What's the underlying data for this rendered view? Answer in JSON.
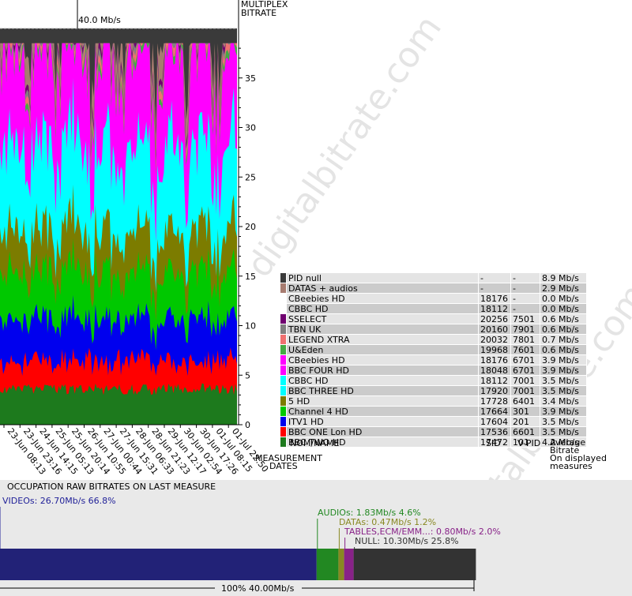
{
  "chart_data": {
    "type": "area",
    "title": "MULTIPLEX BITRATE",
    "y_unit_label": "40.0 Mb/s",
    "ylim": [
      0,
      40
    ],
    "yticks": [
      0,
      5,
      10,
      15,
      20,
      25,
      30,
      35
    ],
    "xlabel": "MEASUREMENT DATES",
    "x_ticks": [
      "23-Jun 08:13",
      "23-Jun 23:16",
      "24-Jun 14:15",
      "25-Jun 05:13",
      "25-Jun 20:14",
      "26-Jun 10:55",
      "27-Jun 00:44",
      "27-Jun 15:31",
      "28-Jun 06:33",
      "28-Jun 21:23",
      "29-Jun 12:17",
      "30-Jun 02:54",
      "30-Jun 17:26",
      "01-Jul 08:15",
      "01-Jul 22:50"
    ],
    "series": [
      {
        "name": "BBC TWO HD",
        "color": "#1d7a1d",
        "average": 4.2
      },
      {
        "name": "BBC ONE Lon HD",
        "color": "#ff0000",
        "average": 3.5
      },
      {
        "name": "ITV1 HD",
        "color": "#0000ee",
        "average": 3.5
      },
      {
        "name": "Channel 4 HD",
        "color": "#00c800",
        "average": 3.9
      },
      {
        "name": "5 HD",
        "color": "#7c7c00",
        "average": 3.4
      },
      {
        "name": "BBC THREE HD",
        "color": "#00ffff",
        "average": 3.5
      },
      {
        "name": "CBBC HD",
        "color": "#00ffff",
        "average": 3.5
      },
      {
        "name": "BBC FOUR HD",
        "color": "#ff00ff",
        "average": 3.9
      },
      {
        "name": "CBeebies HD",
        "color": "#ff00ff",
        "average": 3.9
      },
      {
        "name": "U&Eden",
        "color": "#44aa44",
        "average": 0.6
      },
      {
        "name": "LEGEND XTRA",
        "color": "#f07070",
        "average": 0.7
      },
      {
        "name": "TBN UK",
        "color": "#808080",
        "average": 0.6
      },
      {
        "name": "SSELECT",
        "color": "#700070",
        "average": 0.6
      },
      {
        "name": "DATAS + audios",
        "color": "#a77c70",
        "average": 2.9
      },
      {
        "name": "PID null",
        "color": "#3a3a3a",
        "average": 8.9
      }
    ]
  },
  "legend": {
    "header_name": "NOM/NAME",
    "header_sid": "SID",
    "header_vpid": "V-PID",
    "header_avg_1": "Average",
    "header_avg_2": "Bitrate",
    "header_avg_3": "On displayed",
    "header_avg_4": "measures",
    "rows": [
      {
        "name": "PID null",
        "sid": "-",
        "vpid": "-",
        "bitrate": "8.9 Mb/s",
        "color": "#3a3a3a"
      },
      {
        "name": "DATAS + audios",
        "sid": "-",
        "vpid": "-",
        "bitrate": "2.9 Mb/s",
        "color": "#a77c70"
      },
      {
        "name": "CBeebies HD",
        "sid": "18176",
        "vpid": "-",
        "bitrate": "0.0 Mb/s",
        "color": ""
      },
      {
        "name": "CBBC HD",
        "sid": "18112",
        "vpid": "-",
        "bitrate": "0.0 Mb/s",
        "color": ""
      },
      {
        "name": "SSELECT",
        "sid": "20256",
        "vpid": "7501",
        "bitrate": "0.6 Mb/s",
        "color": "#700070"
      },
      {
        "name": "TBN UK",
        "sid": "20160",
        "vpid": "7901",
        "bitrate": "0.6 Mb/s",
        "color": "#808080"
      },
      {
        "name": "LEGEND XTRA",
        "sid": "20032",
        "vpid": "7801",
        "bitrate": "0.7 Mb/s",
        "color": "#f07070"
      },
      {
        "name": "U&Eden",
        "sid": "19968",
        "vpid": "7601",
        "bitrate": "0.6 Mb/s",
        "color": "#44aa44"
      },
      {
        "name": "CBeebies HD",
        "sid": "18176",
        "vpid": "6701",
        "bitrate": "3.9 Mb/s",
        "color": "#ff00ff"
      },
      {
        "name": "BBC FOUR HD",
        "sid": "18048",
        "vpid": "6701",
        "bitrate": "3.9 Mb/s",
        "color": "#ff00ff"
      },
      {
        "name": "CBBC HD",
        "sid": "18112",
        "vpid": "7001",
        "bitrate": "3.5 Mb/s",
        "color": "#00ffff"
      },
      {
        "name": "BBC THREE HD",
        "sid": "17920",
        "vpid": "7001",
        "bitrate": "3.5 Mb/s",
        "color": "#00ffff"
      },
      {
        "name": "5 HD",
        "sid": "17728",
        "vpid": "6401",
        "bitrate": "3.4 Mb/s",
        "color": "#7c7c00"
      },
      {
        "name": "Channel 4 HD",
        "sid": "17664",
        "vpid": "301",
        "bitrate": "3.9 Mb/s",
        "color": "#00c800"
      },
      {
        "name": "ITV1 HD",
        "sid": "17604",
        "vpid": "201",
        "bitrate": "3.5 Mb/s",
        "color": "#0000ee"
      },
      {
        "name": "BBC ONE Lon HD",
        "sid": "17536",
        "vpid": "6601",
        "bitrate": "3.5 Mb/s",
        "color": "#ff0000"
      },
      {
        "name": "BBC TWO HD",
        "sid": "17472",
        "vpid": "101",
        "bitrate": "4.2 Mb/s",
        "color": "#1d7a1d"
      }
    ]
  },
  "occupation": {
    "title": "OCCUPATION RAW BITRATES ON LAST MEASURE",
    "total_label": "100%  40.00Mb/s",
    "segments": [
      {
        "name": "VIDEOs",
        "label": "VIDEOs: 26.70Mb/s  66.8%",
        "percent": 66.8,
        "color": "#222277",
        "text_color": "#222299"
      },
      {
        "name": "AUDIOs",
        "label": "AUDIOs: 1.83Mb/s  4.6%",
        "percent": 4.6,
        "color": "#228822",
        "text_color": "#228822"
      },
      {
        "name": "DATAs",
        "label": "DATAs: 0.47Mb/s  1.2%",
        "percent": 1.2,
        "color": "#888822",
        "text_color": "#888822"
      },
      {
        "name": "TABLES",
        "label": "TABLES,ECM/EMM...: 0.80Mb/s  2.0%",
        "percent": 2.0,
        "color": "#882288",
        "text_color": "#882288"
      },
      {
        "name": "NULL",
        "label": "NULL: 10.30Mb/s  25.8%",
        "percent": 25.8,
        "color": "#333333",
        "text_color": "#333333"
      }
    ]
  },
  "watermark": {
    "text": "digitalbitrate.com"
  }
}
